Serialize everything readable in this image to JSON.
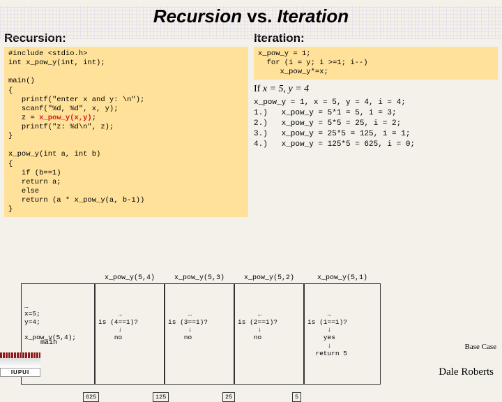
{
  "title_pre": "Recursion ",
  "title_mid": "vs.",
  "title_post": " Iteration",
  "left_h": "Recursion:",
  "right_h": "Iteration:",
  "code_left_a": "#include <stdio.h>\nint x_pow_y(int, int);\n\nmain()\n{\n   printf(\"enter x and y: \\n\");\n   scanf(\"%d, %d\", x, y);\n   z = ",
  "code_left_hl": "x_pow_y(x,y)",
  "code_left_b": ";\n   printf(\"z: %d\\n\", z);\n}\n\nx_pow_y(int a, int b)\n{\n   if (b==1)\n   return a;\n   else\n   return (a * x_pow_y(a, b-1))\n}",
  "iter_code": "x_pow_y = 1;\n  for (i = y; i >=1; i--)\n     x_pow_y*=x;",
  "if_text_a": "If ",
  "if_text_b": "x = 5, y = 4",
  "trace": "x_pow_y = 1, x = 5, y = 4, i = 4;\n1.)   x_pow_y = 5*1 = 5, i = 3;\n2.)   x_pow_y = 5*5 = 25, i = 2;\n3.)   x_pow_y = 25*5 = 125, i = 1;\n4.)   x_pow_y = 125*5 = 625, i = 0;",
  "stack": {
    "c0": {
      "body": "…\nx=5;\ny=4;\n\nx_pow_y(5,4);",
      "label": "main"
    },
    "c1": {
      "hdr": "x_pow_y(5,4)",
      "body": "     …\nis (4==1)?\n     ↓\n    no",
      "ret": "625"
    },
    "c2": {
      "hdr": "x_pow_y(5,3)",
      "body": "     …\nis (3==1)?\n     ↓\n    no",
      "ret": "125"
    },
    "c3": {
      "hdr": "x_pow_y(5,2)",
      "body": "     …\nis (2==1)?\n     ↓\n    no",
      "ret": "25"
    },
    "c4": {
      "hdr": "x_pow_y(5,1)",
      "body": "     …\nis (1==1)?\n     ↓\n    yes\n     ↓\n  return 5",
      "ret": "5"
    }
  },
  "basecase": "Base Case",
  "logo_txt": "IUPUI",
  "footer": "Dale Roberts"
}
